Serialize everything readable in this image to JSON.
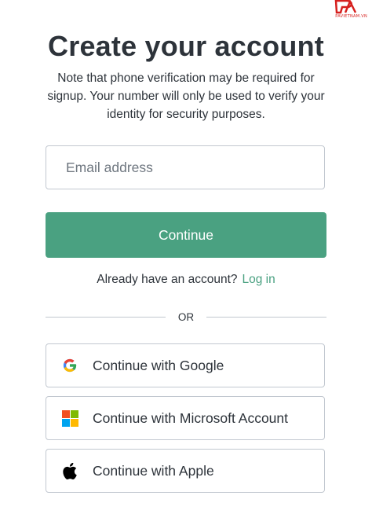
{
  "brand": {
    "name": "PAVIETNAM.VN",
    "color": "#d6201e"
  },
  "page": {
    "title": "Create your account",
    "subtitle": "Note that phone verification may be required for signup. Your number will only be used to verify your identity for security purposes."
  },
  "form": {
    "email_placeholder": "Email address",
    "continue_label": "Continue",
    "accent_color": "#4aa181"
  },
  "login": {
    "prompt": "Already have an account?",
    "link": "Log in"
  },
  "divider": {
    "text": "OR"
  },
  "social": [
    {
      "label": "Continue with Google",
      "icon": "google-icon"
    },
    {
      "label": "Continue with Microsoft Account",
      "icon": "microsoft-icon"
    },
    {
      "label": "Continue with Apple",
      "icon": "apple-icon"
    }
  ]
}
